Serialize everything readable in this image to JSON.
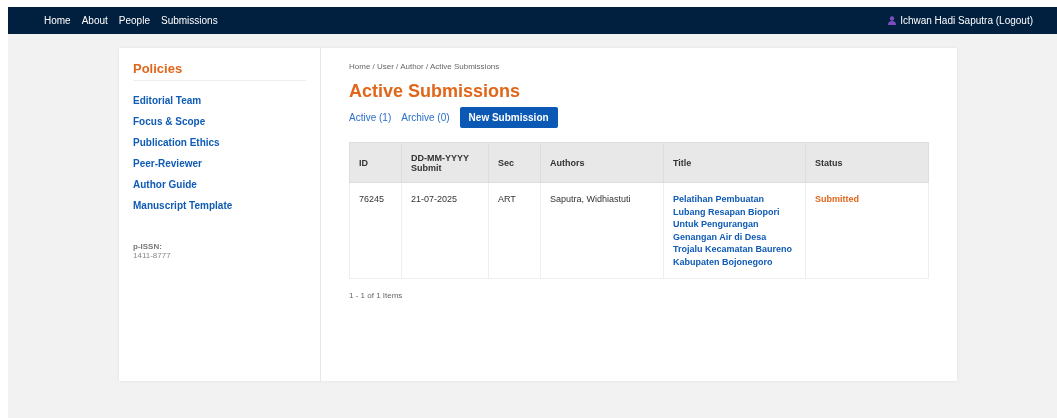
{
  "nav": {
    "links": [
      "Home",
      "About",
      "People",
      "Submissions"
    ],
    "user": "Ichwan Hadi Saputra (Logout)"
  },
  "sidebar": {
    "title": "Policies",
    "items": [
      "Editorial Team",
      "Focus & Scope",
      "Publication Ethics",
      "Peer-Reviewer",
      "Author Guide",
      "Manuscript Template"
    ],
    "issn_label": "p-ISSN:",
    "issn": "1411-8777"
  },
  "breadcrumb": "Home / User / Author / Active Submissions",
  "heading": "Active Submissions",
  "links": [
    "Active (1)",
    "Archive (0)"
  ],
  "new_button": "New Submission",
  "table": {
    "columns": [
      "ID",
      "DD-MM-YYYY Submit",
      "Sec",
      "Authors",
      "Title",
      "Status"
    ],
    "rows": [
      {
        "id": "76245",
        "date": "21-07-2025",
        "sec": "ART",
        "authors": "Saputra, Widhiastuti",
        "title": "Pelatihan Pembuatan Lubang Resapan Biopori Untuk Pengurangan Genangan Air di Desa Trojalu Kecamatan Baureno Kabupaten Bojonegoro",
        "status": "Submitted"
      }
    ]
  },
  "pagination": "1 - 1 of 1 Items"
}
